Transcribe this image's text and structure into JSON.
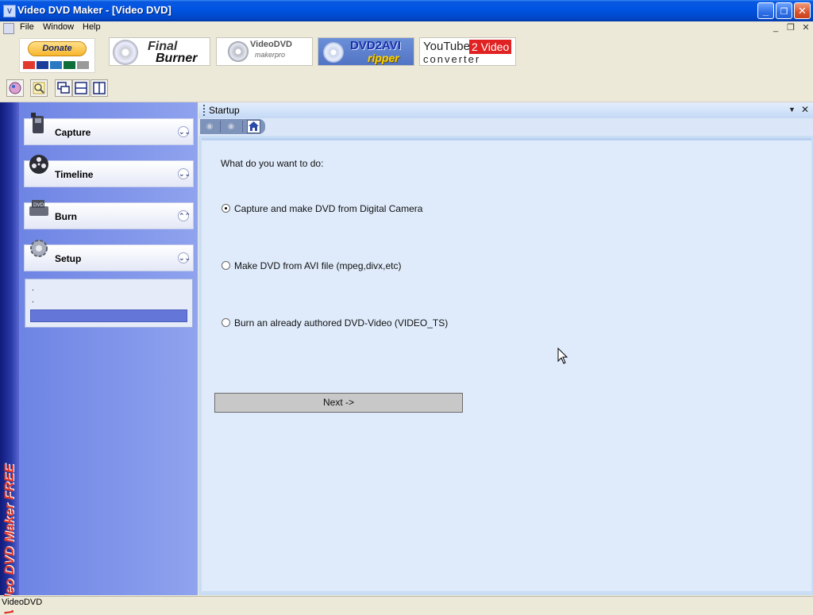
{
  "window": {
    "title": "Video DVD Maker - [Video DVD]",
    "minimize_label": "_",
    "restore_label": "❐",
    "close_label": "✕"
  },
  "menu": {
    "items": [
      "File",
      "Window",
      "Help"
    ],
    "mdi_controls": [
      "_",
      "❐",
      "✕"
    ]
  },
  "banner": {
    "donate_label": "Donate",
    "ads": [
      {
        "line1": "Final",
        "line2": "Burner"
      },
      {
        "line1": "VideoDVD",
        "line2": "makerpro"
      },
      {
        "line1": "DVD2AVI",
        "line2": "ripper"
      },
      {
        "line1": "YouTube",
        "line1b": "2 Video",
        "line2": "converter"
      }
    ]
  },
  "sidebar": {
    "brand": "Video DVD Maker FREE",
    "items": [
      {
        "label": "Capture",
        "chevron": "⌄⌄"
      },
      {
        "label": "Timeline",
        "chevron": "⌄⌄"
      },
      {
        "label": "Burn",
        "chevron": "⌃⌃"
      },
      {
        "label": "Setup",
        "chevron": "⌄⌄"
      }
    ],
    "sub_lines": [
      ".",
      "."
    ]
  },
  "panel": {
    "title": "Startup",
    "dropdown_glyph": "▼",
    "close_glyph": "✕"
  },
  "startup": {
    "question": "What do you want to do:",
    "options": [
      {
        "label": "Capture and make DVD from Digital Camera",
        "selected": true
      },
      {
        "label": "Make DVD from AVI file (mpeg,divx,etc)",
        "selected": false
      },
      {
        "label": "Burn an already authored DVD-Video (VIDEO_TS)",
        "selected": false
      }
    ],
    "next_label": "Next ->"
  },
  "statusbar": {
    "text": "VideoDVD"
  },
  "colors": {
    "titlebar": "#0054e3",
    "content_bg": "#dfebfb",
    "sidebar_bg": "#7f93e8",
    "brand_red": "#e03a2a"
  }
}
